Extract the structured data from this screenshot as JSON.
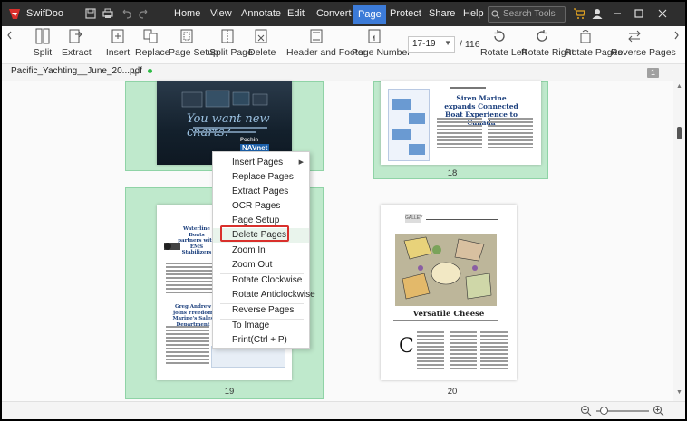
{
  "app": {
    "name": "SwifDoo",
    "brand_color": "#3c7bd8",
    "menus": [
      "Home",
      "View",
      "Annotate",
      "Edit",
      "Convert",
      "Page",
      "Protect",
      "Share",
      "Help"
    ],
    "active_menu": "Page",
    "search_placeholder": "Search Tools"
  },
  "toolbar": {
    "split_label": "Split",
    "extract_label": "Extract",
    "insert_label": "Insert",
    "replace_label": "Replace",
    "page_setup_label": "Page Setup",
    "split_page_label": "Split Page",
    "delete_label": "Delete",
    "header_footer_label": "Header and Footer",
    "page_number_label": "Page Number",
    "page_range": "17-19",
    "page_total": "/ 116",
    "rotate_left_label": "Rotate Left",
    "rotate_right_label": "Rotate Right",
    "rotate_pages_label": "Rotate Pages",
    "reverse_pages_label": "Reverse Pages"
  },
  "tabs": {
    "document": "Pacific_Yachting__June_20...pdf",
    "add": "+",
    "count": "1"
  },
  "pages": {
    "p17": {
      "ad_text": "You want new charts?",
      "brand_small": "Pochin",
      "brand": "NAVnet"
    },
    "p18": {
      "number": "18",
      "headline": "Siren Marine expands Connected Boat Experience to Canada"
    },
    "p19": {
      "number": "19",
      "headline": "Waterline Boats partners with EMS Stabilizers",
      "sub_headline": "Greg Andrew joins Freedom Marine's Sales Department"
    },
    "p20": {
      "number": "20",
      "section": "GALLEY",
      "title": "Versatile Cheese",
      "drop_cap": "C"
    }
  },
  "context_menu": {
    "items": [
      "Insert Pages",
      "Replace Pages",
      "Extract Pages",
      "OCR Pages",
      "Page Setup",
      "Delete Pages",
      "Zoom In",
      "Zoom Out",
      "Rotate Clockwise",
      "Rotate Anticlockwise",
      "Reverse Pages",
      "To Image",
      "Print(Ctrl + P)"
    ],
    "highlighted": "Delete Pages",
    "highlight_color": "#d9302c"
  }
}
